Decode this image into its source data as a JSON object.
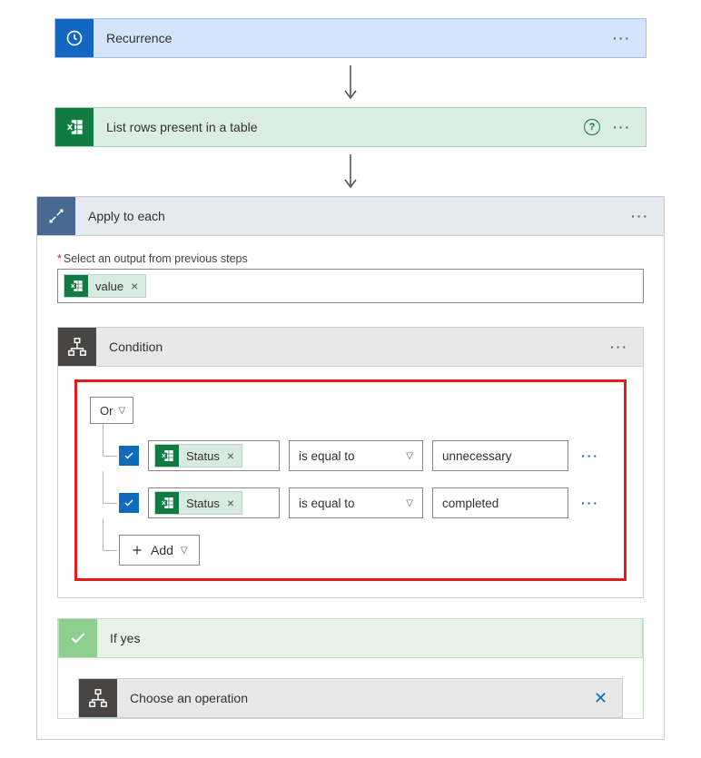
{
  "steps": {
    "recurrence": {
      "title": "Recurrence"
    },
    "list_rows": {
      "title": "List rows present in a table"
    },
    "apply_each": {
      "title": "Apply to each"
    },
    "condition": {
      "title": "Condition"
    },
    "if_yes": {
      "title": "If yes"
    },
    "choose_op": {
      "title": "Choose an operation"
    }
  },
  "apply_each": {
    "output_label": "Select an output from previous steps",
    "token_label": "value"
  },
  "condition": {
    "group_operator": "Or",
    "rows": [
      {
        "left_token": "Status",
        "operator": "is equal to",
        "right": "unnecessary"
      },
      {
        "left_token": "Status",
        "operator": "is equal to",
        "right": "completed"
      }
    ],
    "add_label": "Add"
  }
}
